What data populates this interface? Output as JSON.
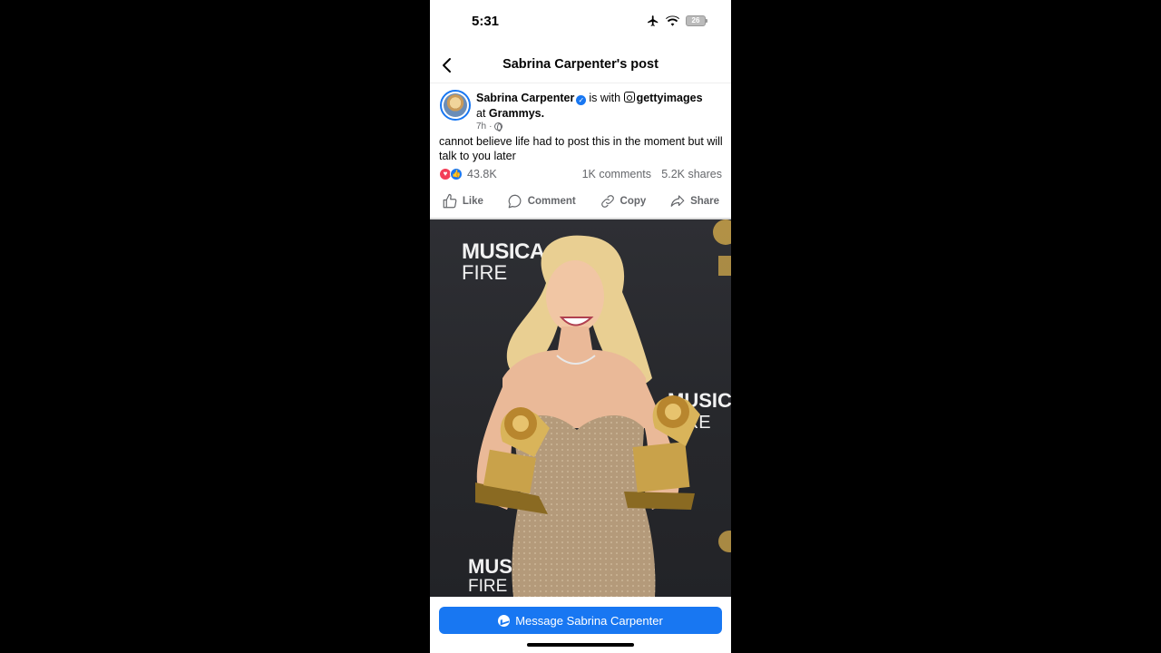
{
  "status_bar": {
    "time": "5:31",
    "battery": "26",
    "icons": [
      "airplane-icon",
      "wifi-icon",
      "battery-icon"
    ]
  },
  "header": {
    "title": "Sabrina Carpenter's post",
    "back_icon": "chevron-left-icon"
  },
  "post": {
    "author": "Sabrina Carpenter",
    "with_text": "is with",
    "tagged": "gettyimages",
    "at_text": "at",
    "location": "Grammys.",
    "time": "7h",
    "audience_icon": "globe-icon",
    "text": "cannot believe life had to post this in the moment but will talk to you later"
  },
  "counts": {
    "reactions": "43.8K",
    "comments": "1K comments",
    "shares": "5.2K shares"
  },
  "actions": {
    "like": "Like",
    "comment": "Comment",
    "copy": "Copy",
    "share": "Share"
  },
  "photo": {
    "backdrop_text_1": "MUSICA",
    "backdrop_text_2": "FIRE",
    "backdrop_text_3": "MUSIC",
    "backdrop_text_4": "FIRE",
    "backdrop_text_5": "MUS",
    "backdrop_text_6": "FIRE"
  },
  "footer": {
    "message_button": "Message Sabrina Carpenter"
  },
  "colors": {
    "accent": "#1877f2",
    "love": "#f33e58",
    "secondary_text": "#65676b",
    "backdrop": "#2a2b30",
    "gold": "#c9a24a"
  }
}
